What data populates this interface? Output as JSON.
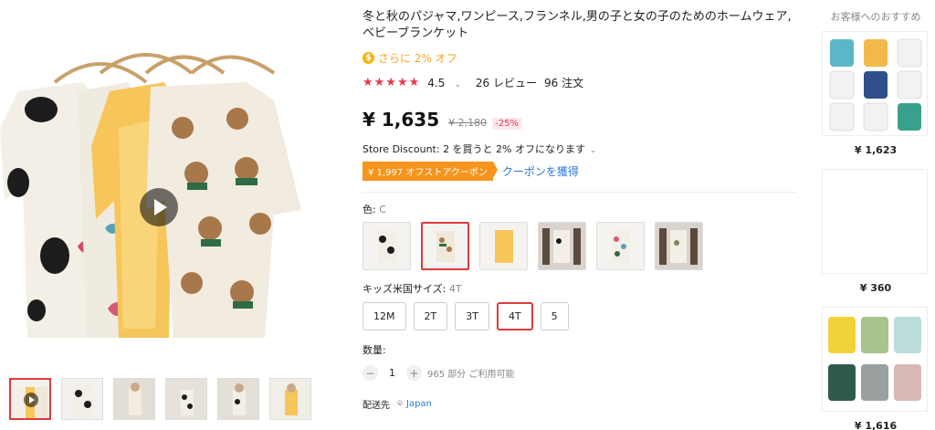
{
  "product": {
    "title": "冬と秋のパジャマ,ワンピース,フランネル,男の子と女の子のためのホームウェア,ベビーブランケット",
    "promo_text": "さらに 2% オフ",
    "rating": "4.5",
    "reviews": "26 レビュー",
    "orders": "96 注文",
    "price": "¥ 1,635",
    "old_price": "¥ 2,180",
    "discount": "-25%",
    "store_discount": "Store Discount: 2 を買うと 2% オフになります",
    "coupon": "¥ 1,997 オフストアクーポン",
    "get_coupon": "クーポンを獲得",
    "color_label": "色:",
    "color_value": "C",
    "size_label": "キッズ米国サイズ:",
    "size_value": "4T",
    "sizes": [
      "12M",
      "2T",
      "3T",
      "4T",
      "5"
    ],
    "qty_label": "数量:",
    "qty_minus": "−",
    "qty_value": "1",
    "qty_plus": "+",
    "qty_available": "965 部分 ご利用可能",
    "ship_label": "配送先",
    "ship_dest": "Japan"
  },
  "recommendations": {
    "title": "お客様へのおすすめ",
    "items": [
      {
        "price": "¥ 1,623"
      },
      {
        "price": "¥ 360"
      },
      {
        "price": "¥ 1,616"
      }
    ]
  },
  "colors": {
    "accent": "#e03a3a",
    "star": "#e8384f",
    "link": "#2a78d8",
    "coupon": "#f7941d",
    "promo": "#f5a623"
  },
  "icons": {
    "promo": "coin-icon",
    "play": "play-icon",
    "location": "location-pin-icon"
  }
}
